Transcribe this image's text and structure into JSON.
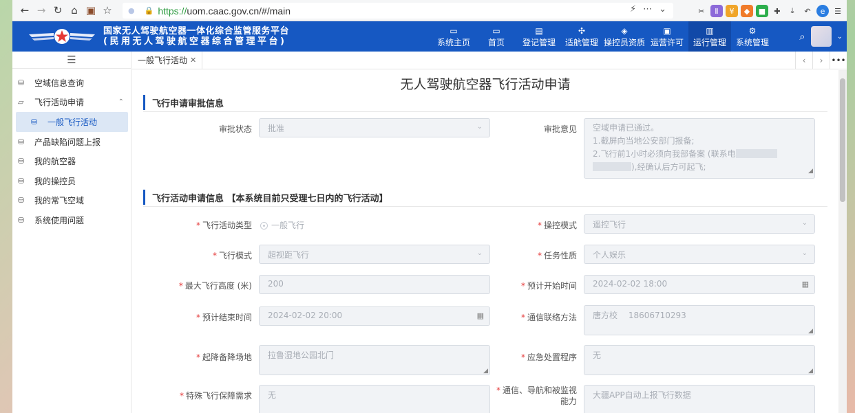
{
  "browser": {
    "url_scheme": "https://",
    "url_rest": "uom.caac.gov.cn/#/main"
  },
  "header": {
    "title_line1": "国家无人驾驶航空器一体化综合监管服务平台",
    "title_line2": "(民用无人驾驶航空器综合管理平台)",
    "nav": [
      {
        "label": "系统主页",
        "icon": "calendar-icon"
      },
      {
        "label": "首页",
        "icon": "monitor-icon"
      },
      {
        "label": "登记管理",
        "icon": "document-icon"
      },
      {
        "label": "适航管理",
        "icon": "drone-icon"
      },
      {
        "label": "操控员资质",
        "icon": "shield-icon"
      },
      {
        "label": "运营许可",
        "icon": "license-icon"
      },
      {
        "label": "运行管理",
        "icon": "clipboard-icon"
      },
      {
        "label": "系统管理",
        "icon": "settings-icon"
      }
    ],
    "active_nav": "运行管理"
  },
  "sidebar": {
    "items": [
      {
        "label": "空域信息查询"
      },
      {
        "label": "飞行活动申请"
      },
      {
        "label": "一般飞行活动"
      },
      {
        "label": "产品缺陷问题上报"
      },
      {
        "label": "我的航空器"
      },
      {
        "label": "我的操控员"
      },
      {
        "label": "我的常飞空域"
      },
      {
        "label": "系统使用问题"
      }
    ]
  },
  "tabs": [
    {
      "label": "一般飞行活动"
    }
  ],
  "page": {
    "title": "无人驾驶航空器飞行活动申请",
    "section1": "飞行申请审批信息",
    "section2": "飞行活动申请信息 【本系统目前只受理七日内的飞行活动】"
  },
  "approval": {
    "status_label": "审批状态",
    "status_value": "批准",
    "opinion_label": "审批意见",
    "opinion_line1": "空域申请已通过。",
    "opinion_line2": "1.截屏向当地公安部门报备;",
    "opinion_line3": "2.飞行前1小时必须向我部备案 (联系电",
    "opinion_line4": "),经确认后方可起飞;"
  },
  "form": {
    "activity_type_label": "飞行活动类型",
    "activity_type_value": "一般飞行",
    "control_mode_label": "操控模式",
    "control_mode_value": "遥控飞行",
    "flight_mode_label": "飞行模式",
    "flight_mode_value": "超视距飞行",
    "task_nature_label": "任务性质",
    "task_nature_value": "个人娱乐",
    "max_altitude_label": "最大飞行高度 (米)",
    "max_altitude_value": "200",
    "start_time_label": "预计开始时间",
    "start_time_value": "2024-02-02 18:00",
    "end_time_label": "预计结束时间",
    "end_time_value": "2024-02-02 20:00",
    "contact_label": "通信联络方法",
    "contact_value": "唐方校　 18606710293",
    "airfield_label": "起降备降场地",
    "airfield_value": "拉鲁湿地公园北门",
    "emergency_label": "应急处置程序",
    "emergency_value": "无",
    "special_label": "特殊飞行保障需求",
    "special_value": "无",
    "cns_label_line1": "通信、导航和被监视",
    "cns_label_line2": "能力",
    "cns_value": "大疆APP自动上报飞行数据"
  }
}
